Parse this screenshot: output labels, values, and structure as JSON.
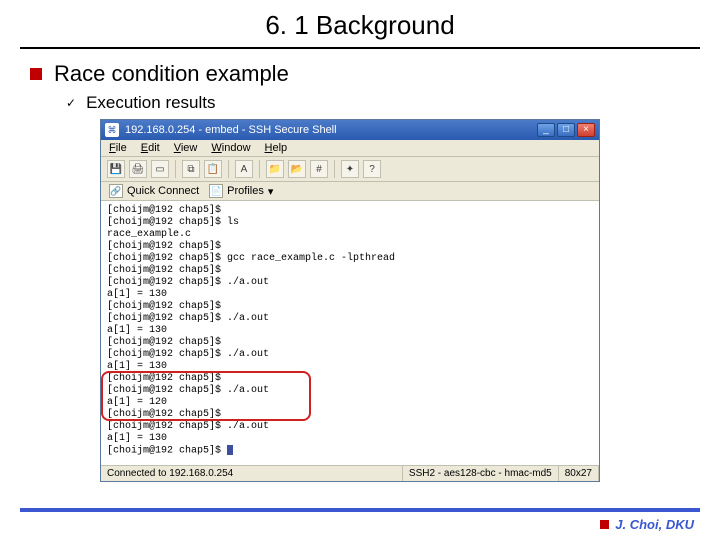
{
  "slide": {
    "title": "6. 1 Background",
    "bullet1": "Race condition example",
    "bullet2": "Execution results"
  },
  "ssh": {
    "title": "192.168.0.254 - embed - SSH Secure Shell",
    "menu": {
      "file": "File",
      "edit": "Edit",
      "view": "View",
      "window": "Window",
      "help": "Help"
    },
    "quick": {
      "connect": "Quick Connect",
      "profiles": "Profiles"
    },
    "winbtn": {
      "min": "_",
      "max": "□",
      "close": "×"
    },
    "icons": {
      "app": "⌘",
      "save": "💾",
      "print": "🖨",
      "new": "▭",
      "copy": "⧉",
      "paste": "📋",
      "find": "A",
      "folder1": "📁",
      "folder2": "📂",
      "hash": "#",
      "sparkle": "✦",
      "help": "?"
    },
    "term": [
      "[choijm@192 chap5]$",
      "[choijm@192 chap5]$ ls",
      "race_example.c",
      "[choijm@192 chap5]$",
      "[choijm@192 chap5]$ gcc race_example.c -lpthread",
      "[choijm@192 chap5]$",
      "[choijm@192 chap5]$ ./a.out",
      "a[1] = 130",
      "[choijm@192 chap5]$",
      "[choijm@192 chap5]$ ./a.out",
      "a[1] = 130",
      "[choijm@192 chap5]$",
      "[choijm@192 chap5]$ ./a.out",
      "a[1] = 130",
      "[choijm@192 chap5]$",
      "[choijm@192 chap5]$ ./a.out",
      "a[1] = 120",
      "[choijm@192 chap5]$",
      "[choijm@192 chap5]$ ./a.out",
      "a[1] = 130",
      "[choijm@192 chap5]$ "
    ],
    "status": {
      "conn": "Connected to 192.168.0.254",
      "proto": "SSH2 - aes128-cbc - hmac-md5",
      "size": "80x27"
    }
  },
  "footer": {
    "author": "J. Choi, DKU"
  }
}
